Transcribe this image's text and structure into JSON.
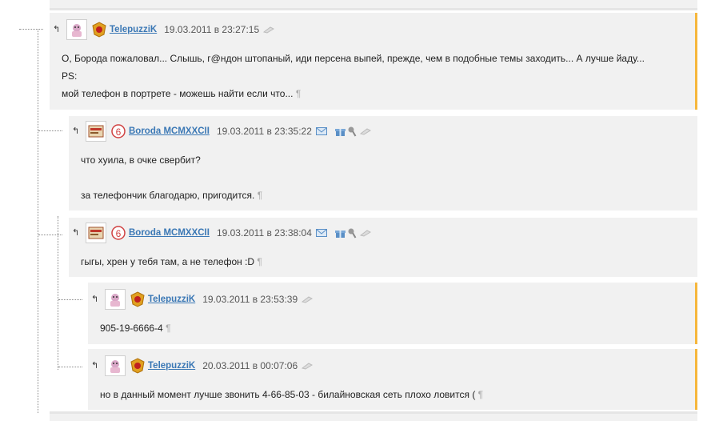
{
  "comments": [
    {
      "author": "TelepuzziK",
      "date": "19.03.2011 в 23:27:15",
      "lines": [
        "О, Борода пожаловал... Слышь, г@ндон штопаный, иди персена выпей, прежде, чем в подобные темы заходить... А лучше йаду...",
        "PS:",
        "мой телефон в портрете - можешь найти если что..."
      ]
    },
    {
      "author": "Boroda MCMXXCII",
      "date": "19.03.2011 в 23:35:22",
      "lines": [
        "что хуила, в очке свербит?",
        "",
        "за телефончик благодарю, пригодится."
      ]
    },
    {
      "author": "Boroda MCMXXCII",
      "date": "19.03.2011 в 23:38:04",
      "lines": [
        "гыгы, хрен у тебя там, а не телефон :D"
      ]
    },
    {
      "author": "TelepuzziK",
      "date": "19.03.2011 в 23:53:39",
      "lines": [
        "905-19-6666-4"
      ]
    },
    {
      "author": "TelepuzziK",
      "date": "20.03.2011 в 00:07:06",
      "lines": [
        "но в данный момент лучше звонить 4-66-85-03 - билайновская сеть плохо ловится ("
      ]
    }
  ],
  "reply_glyph": "↰",
  "pilcrow": "¶",
  "colors": {
    "link": "#3b78b5",
    "accent": "#f6b73c",
    "bg": "#f1f1f1"
  }
}
